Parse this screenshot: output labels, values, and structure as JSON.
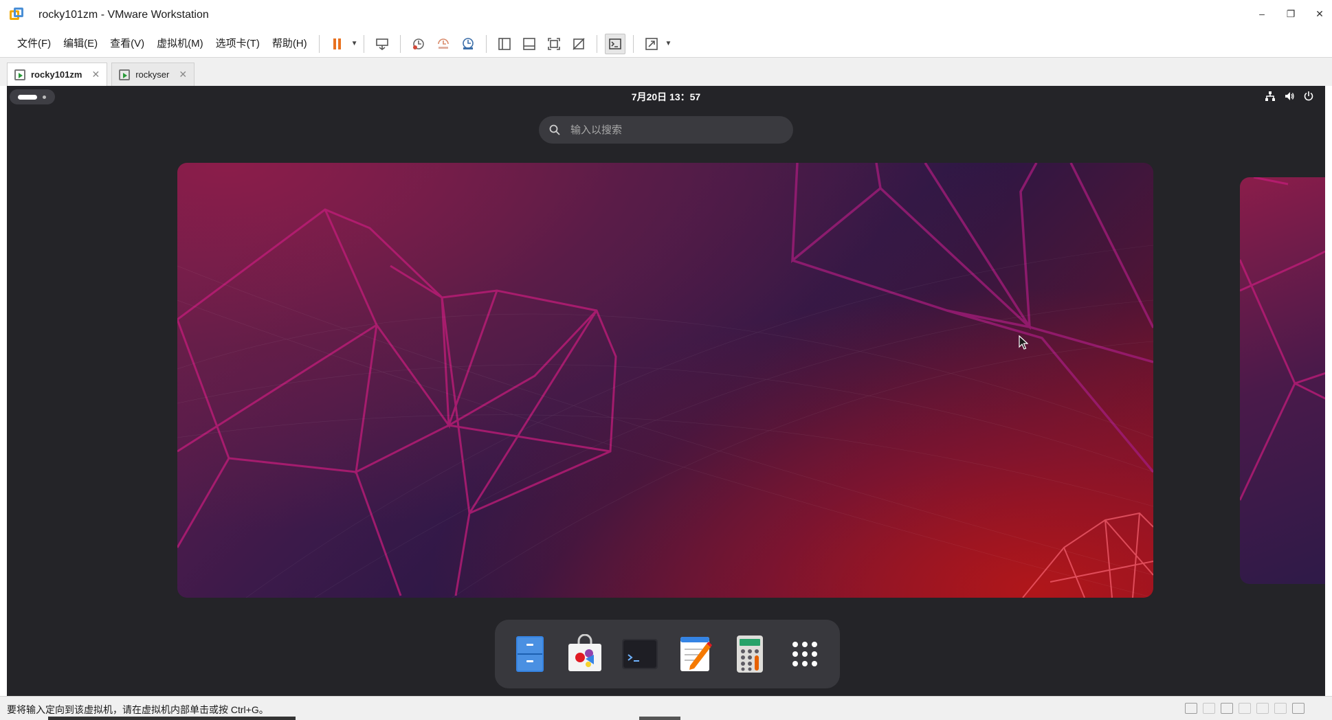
{
  "window": {
    "title": "rocky101zm - VMware Workstation",
    "controls": {
      "minimize": "–",
      "restore": "❐",
      "close": "✕"
    }
  },
  "menu": [
    "文件(F)",
    "编辑(E)",
    "查看(V)",
    "虚拟机(M)",
    "选项卡(T)",
    "帮助(H)"
  ],
  "toolbar": {
    "icons": [
      "pause-icon",
      "send-keys-icon",
      "snapshot-icon",
      "revert-snapshot-icon",
      "snapshot-manager-icon",
      "library-icon",
      "thumbnail-bar-icon",
      "fullscreen-icon",
      "unity-icon",
      "console-view-icon",
      "stretch-icon"
    ],
    "accent": "#e8711f"
  },
  "tabs": [
    {
      "label": "rocky101zm",
      "active": true
    },
    {
      "label": "rockyser",
      "active": false
    }
  ],
  "guest": {
    "clock": "7月20日  13：57",
    "status_icons": [
      "network-icon",
      "volume-icon",
      "power-icon"
    ],
    "search_placeholder": "输入以搜索",
    "dock": [
      "files-icon",
      "software-icon",
      "terminal-icon",
      "text-editor-icon",
      "calculator-icon",
      "show-apps-icon"
    ],
    "background_colors": [
      "#6e1f4f",
      "#2a1745",
      "#b0161a"
    ]
  },
  "statusbar": {
    "message": "要将输入定向到该虚拟机，请在虚拟机内部单击或按 Ctrl+G。"
  }
}
